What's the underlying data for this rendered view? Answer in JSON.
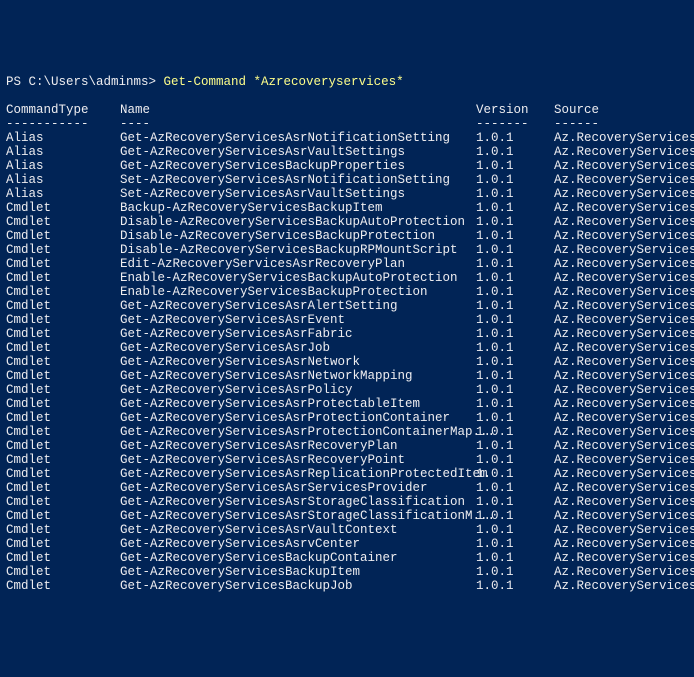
{
  "prompt_prefix": "PS C:\\Users\\adminms> ",
  "command": "Get-Command *Azrecoveryservices*",
  "headers": {
    "type": "CommandType",
    "name": "Name",
    "ver": "Version",
    "src": "Source",
    "type_ul": "-----------",
    "name_ul": "----",
    "ver_ul": "-------",
    "src_ul": "------"
  },
  "rows": [
    {
      "type": "Alias",
      "name": "Get-AzRecoveryServicesAsrNotificationSetting",
      "ver": "1.0.1",
      "src": "Az.RecoveryServices"
    },
    {
      "type": "Alias",
      "name": "Get-AzRecoveryServicesAsrVaultSettings",
      "ver": "1.0.1",
      "src": "Az.RecoveryServices"
    },
    {
      "type": "Alias",
      "name": "Get-AzRecoveryServicesBackupProperties",
      "ver": "1.0.1",
      "src": "Az.RecoveryServices"
    },
    {
      "type": "Alias",
      "name": "Set-AzRecoveryServicesAsrNotificationSetting",
      "ver": "1.0.1",
      "src": "Az.RecoveryServices"
    },
    {
      "type": "Alias",
      "name": "Set-AzRecoveryServicesAsrVaultSettings",
      "ver": "1.0.1",
      "src": "Az.RecoveryServices"
    },
    {
      "type": "Cmdlet",
      "name": "Backup-AzRecoveryServicesBackupItem",
      "ver": "1.0.1",
      "src": "Az.RecoveryServices"
    },
    {
      "type": "Cmdlet",
      "name": "Disable-AzRecoveryServicesBackupAutoProtection",
      "ver": "1.0.1",
      "src": "Az.RecoveryServices"
    },
    {
      "type": "Cmdlet",
      "name": "Disable-AzRecoveryServicesBackupProtection",
      "ver": "1.0.1",
      "src": "Az.RecoveryServices"
    },
    {
      "type": "Cmdlet",
      "name": "Disable-AzRecoveryServicesBackupRPMountScript",
      "ver": "1.0.1",
      "src": "Az.RecoveryServices"
    },
    {
      "type": "Cmdlet",
      "name": "Edit-AzRecoveryServicesAsrRecoveryPlan",
      "ver": "1.0.1",
      "src": "Az.RecoveryServices"
    },
    {
      "type": "Cmdlet",
      "name": "Enable-AzRecoveryServicesBackupAutoProtection",
      "ver": "1.0.1",
      "src": "Az.RecoveryServices"
    },
    {
      "type": "Cmdlet",
      "name": "Enable-AzRecoveryServicesBackupProtection",
      "ver": "1.0.1",
      "src": "Az.RecoveryServices"
    },
    {
      "type": "Cmdlet",
      "name": "Get-AzRecoveryServicesAsrAlertSetting",
      "ver": "1.0.1",
      "src": "Az.RecoveryServices"
    },
    {
      "type": "Cmdlet",
      "name": "Get-AzRecoveryServicesAsrEvent",
      "ver": "1.0.1",
      "src": "Az.RecoveryServices"
    },
    {
      "type": "Cmdlet",
      "name": "Get-AzRecoveryServicesAsrFabric",
      "ver": "1.0.1",
      "src": "Az.RecoveryServices"
    },
    {
      "type": "Cmdlet",
      "name": "Get-AzRecoveryServicesAsrJob",
      "ver": "1.0.1",
      "src": "Az.RecoveryServices"
    },
    {
      "type": "Cmdlet",
      "name": "Get-AzRecoveryServicesAsrNetwork",
      "ver": "1.0.1",
      "src": "Az.RecoveryServices"
    },
    {
      "type": "Cmdlet",
      "name": "Get-AzRecoveryServicesAsrNetworkMapping",
      "ver": "1.0.1",
      "src": "Az.RecoveryServices"
    },
    {
      "type": "Cmdlet",
      "name": "Get-AzRecoveryServicesAsrPolicy",
      "ver": "1.0.1",
      "src": "Az.RecoveryServices"
    },
    {
      "type": "Cmdlet",
      "name": "Get-AzRecoveryServicesAsrProtectableItem",
      "ver": "1.0.1",
      "src": "Az.RecoveryServices"
    },
    {
      "type": "Cmdlet",
      "name": "Get-AzRecoveryServicesAsrProtectionContainer",
      "ver": "1.0.1",
      "src": "Az.RecoveryServices"
    },
    {
      "type": "Cmdlet",
      "name": "Get-AzRecoveryServicesAsrProtectionContainerMap...",
      "ver": "1.0.1",
      "src": "Az.RecoveryServices"
    },
    {
      "type": "Cmdlet",
      "name": "Get-AzRecoveryServicesAsrRecoveryPlan",
      "ver": "1.0.1",
      "src": "Az.RecoveryServices"
    },
    {
      "type": "Cmdlet",
      "name": "Get-AzRecoveryServicesAsrRecoveryPoint",
      "ver": "1.0.1",
      "src": "Az.RecoveryServices"
    },
    {
      "type": "Cmdlet",
      "name": "Get-AzRecoveryServicesAsrReplicationProtectedItem",
      "ver": "1.0.1",
      "src": "Az.RecoveryServices"
    },
    {
      "type": "Cmdlet",
      "name": "Get-AzRecoveryServicesAsrServicesProvider",
      "ver": "1.0.1",
      "src": "Az.RecoveryServices"
    },
    {
      "type": "Cmdlet",
      "name": "Get-AzRecoveryServicesAsrStorageClassification",
      "ver": "1.0.1",
      "src": "Az.RecoveryServices"
    },
    {
      "type": "Cmdlet",
      "name": "Get-AzRecoveryServicesAsrStorageClassificationM...",
      "ver": "1.0.1",
      "src": "Az.RecoveryServices"
    },
    {
      "type": "Cmdlet",
      "name": "Get-AzRecoveryServicesAsrVaultContext",
      "ver": "1.0.1",
      "src": "Az.RecoveryServices"
    },
    {
      "type": "Cmdlet",
      "name": "Get-AzRecoveryServicesAsrvCenter",
      "ver": "1.0.1",
      "src": "Az.RecoveryServices"
    },
    {
      "type": "Cmdlet",
      "name": "Get-AzRecoveryServicesBackupContainer",
      "ver": "1.0.1",
      "src": "Az.RecoveryServices"
    },
    {
      "type": "Cmdlet",
      "name": "Get-AzRecoveryServicesBackupItem",
      "ver": "1.0.1",
      "src": "Az.RecoveryServices"
    },
    {
      "type": "Cmdlet",
      "name": "Get-AzRecoveryServicesBackupJob",
      "ver": "1.0.1",
      "src": "Az.RecoveryServices"
    }
  ]
}
